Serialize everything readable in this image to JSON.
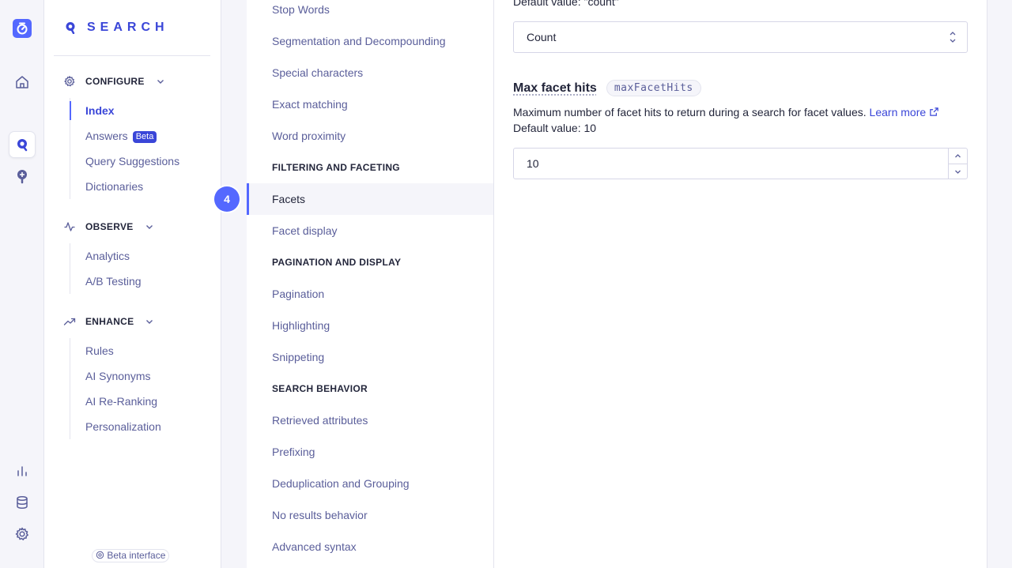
{
  "brand": {
    "name": "SEARCH"
  },
  "rail": {
    "icons": [
      "algolia-logo-icon",
      "home-icon",
      "search-product-icon",
      "recommend-product-icon",
      "analytics-icon",
      "data-sources-icon",
      "settings-icon"
    ]
  },
  "nav": {
    "sections": [
      {
        "label": "CONFIGURE",
        "icon": "gear-icon",
        "items": [
          {
            "label": "Index",
            "active": true
          },
          {
            "label": "Answers",
            "badge": "Beta"
          },
          {
            "label": "Query Suggestions"
          },
          {
            "label": "Dictionaries"
          }
        ]
      },
      {
        "label": "OBSERVE",
        "icon": "pulse-icon",
        "items": [
          {
            "label": "Analytics"
          },
          {
            "label": "A/B Testing"
          }
        ]
      },
      {
        "label": "ENHANCE",
        "icon": "trend-up-icon",
        "items": [
          {
            "label": "Rules"
          },
          {
            "label": "AI Synonyms"
          },
          {
            "label": "AI Re-Ranking"
          },
          {
            "label": "Personalization"
          }
        ]
      }
    ],
    "beta_interface": "Beta interface"
  },
  "step_badge": "4",
  "settings": {
    "items": [
      "Stop Words",
      "Segmentation and Decompounding",
      "Special characters",
      "Exact matching",
      "Word proximity"
    ],
    "group_filtering": "FILTERING AND FACETING",
    "filtering_items": [
      "Facets",
      "Facet display"
    ],
    "group_pagination": "PAGINATION AND DISPLAY",
    "pagination_items": [
      "Pagination",
      "Highlighting",
      "Snippeting"
    ],
    "group_search": "SEARCH BEHAVIOR",
    "search_items": [
      "Retrieved attributes",
      "Prefixing",
      "Deduplication and Grouping",
      "No results behavior",
      "Advanced syntax"
    ],
    "active": "Facets"
  },
  "main": {
    "prev_default": "Default value: \"count\"",
    "sort_select_value": "Count",
    "max_facet_hits": {
      "title": "Max facet hits",
      "code": "maxFacetHits",
      "description": "Maximum number of facet hits to return during a search for facet values.",
      "learn_more": "Learn more",
      "default_value": "Default value: 10",
      "value": "10"
    }
  }
}
